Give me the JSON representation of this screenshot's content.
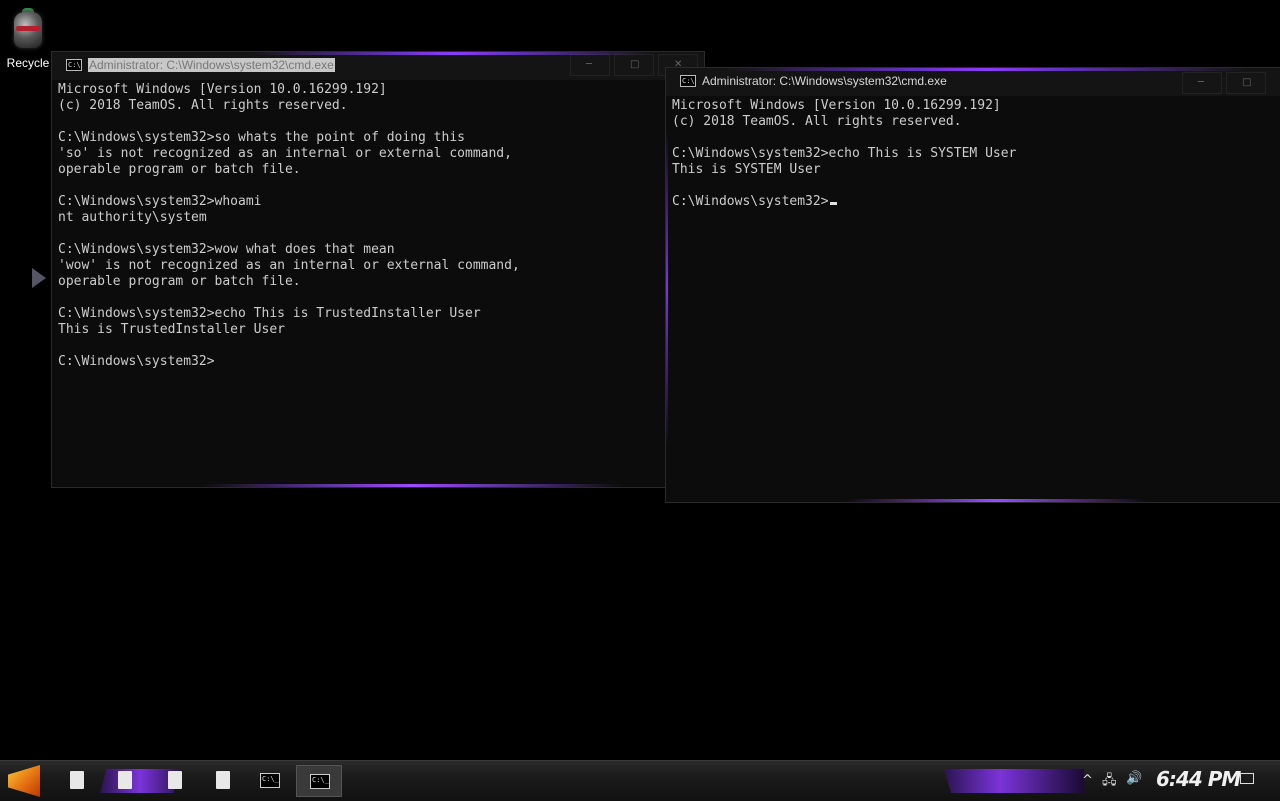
{
  "desktop": {
    "recycle_label": "Recycle"
  },
  "window_left": {
    "title": "Administrator: C:\\Windows\\system32\\cmd.exe",
    "icon_text": "C:\\",
    "minimize": "─",
    "maximize": "□",
    "close": "✕",
    "lines": [
      "Microsoft Windows [Version 10.0.16299.192]",
      "(c) 2018 TeamOS. All rights reserved.",
      "",
      "C:\\Windows\\system32>so whats the point of doing this",
      "'so' is not recognized as an internal or external command,",
      "operable program or batch file.",
      "",
      "C:\\Windows\\system32>whoami",
      "nt authority\\system",
      "",
      "C:\\Windows\\system32>wow what does that mean",
      "'wow' is not recognized as an internal or external command,",
      "operable program or batch file.",
      "",
      "C:\\Windows\\system32>echo This is TrustedInstaller User",
      "This is TrustedInstaller User",
      "",
      "C:\\Windows\\system32>"
    ]
  },
  "window_right": {
    "title": "Administrator: C:\\Windows\\system32\\cmd.exe",
    "icon_text": "C:\\",
    "minimize": "─",
    "maximize": "□",
    "lines": [
      "Microsoft Windows [Version 10.0.16299.192]",
      "(c) 2018 TeamOS. All rights reserved.",
      "",
      "C:\\Windows\\system32>echo This is SYSTEM User",
      "This is SYSTEM User",
      ""
    ],
    "prompt": "C:\\Windows\\system32>"
  },
  "taskbar": {
    "cmd_icon_text": "C:\\_",
    "tray_up": "^",
    "tray_network": "🖧",
    "tray_volume": "🔊",
    "clock": "6:44 PM"
  },
  "colors": {
    "accent": "#8a3cff",
    "console_bg": "#0c0c0c",
    "console_fg": "#cccccc"
  }
}
